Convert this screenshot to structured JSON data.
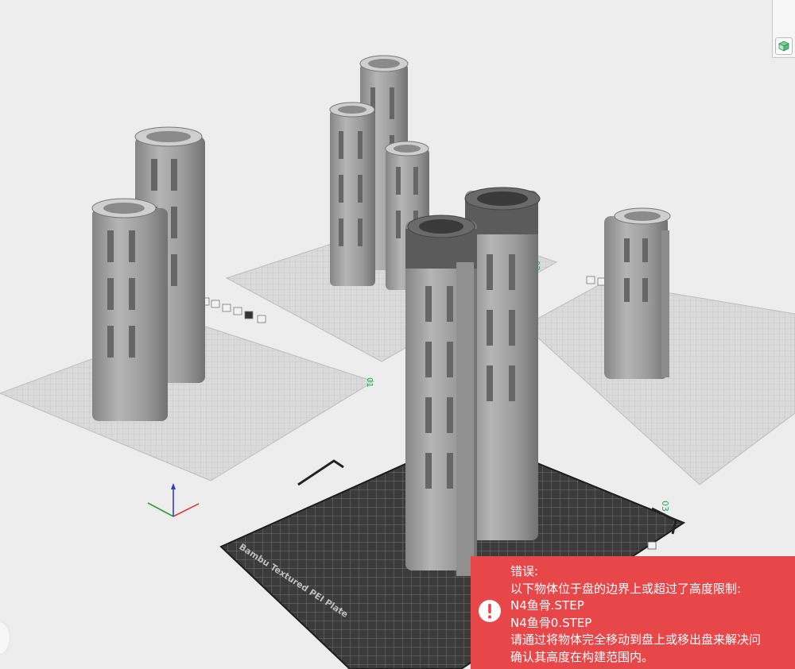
{
  "plate_labels": {
    "plate1": "01",
    "plate2": "02",
    "plate3": "03",
    "plate3_brand": "Bambu Textured PEI Plate"
  },
  "colors": {
    "error_bg": "#e8474a",
    "plate_dark": "#3b3b3b",
    "plate_light": "#dadada",
    "plate_number": "#1fae5b",
    "model_gray": "#a6a6a6",
    "model_dark": "#6e6e6e"
  },
  "icons": {
    "view_cube": "cube-icon",
    "error": "exclamation-circle-icon"
  },
  "error": {
    "title": "错误:",
    "description": "以下物体位于盘的边界上或超过了高度限制:",
    "objects": [
      "N4鱼骨.STEP",
      "N4鱼骨0.STEP"
    ],
    "hint_line1": "请通过将物体完全移动到盘上或移出盘来解决问",
    "hint_line2": "确认其高度在构建范围内。"
  }
}
